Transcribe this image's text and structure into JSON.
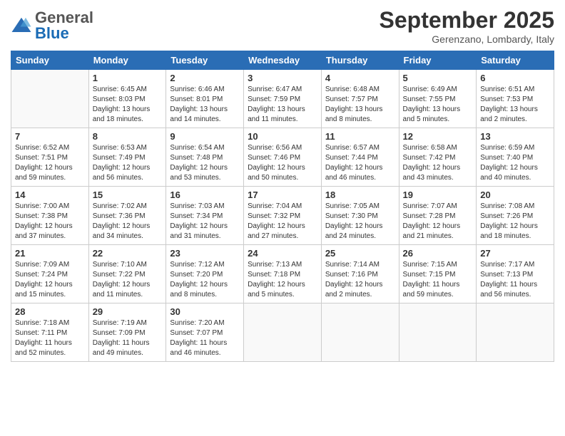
{
  "header": {
    "logo_general": "General",
    "logo_blue": "Blue",
    "title": "September 2025",
    "location": "Gerenzano, Lombardy, Italy"
  },
  "weekdays": [
    "Sunday",
    "Monday",
    "Tuesday",
    "Wednesday",
    "Thursday",
    "Friday",
    "Saturday"
  ],
  "weeks": [
    [
      {
        "day": "",
        "sunrise": "",
        "sunset": "",
        "daylight": ""
      },
      {
        "day": "1",
        "sunrise": "Sunrise: 6:45 AM",
        "sunset": "Sunset: 8:03 PM",
        "daylight": "Daylight: 13 hours and 18 minutes."
      },
      {
        "day": "2",
        "sunrise": "Sunrise: 6:46 AM",
        "sunset": "Sunset: 8:01 PM",
        "daylight": "Daylight: 13 hours and 14 minutes."
      },
      {
        "day": "3",
        "sunrise": "Sunrise: 6:47 AM",
        "sunset": "Sunset: 7:59 PM",
        "daylight": "Daylight: 13 hours and 11 minutes."
      },
      {
        "day": "4",
        "sunrise": "Sunrise: 6:48 AM",
        "sunset": "Sunset: 7:57 PM",
        "daylight": "Daylight: 13 hours and 8 minutes."
      },
      {
        "day": "5",
        "sunrise": "Sunrise: 6:49 AM",
        "sunset": "Sunset: 7:55 PM",
        "daylight": "Daylight: 13 hours and 5 minutes."
      },
      {
        "day": "6",
        "sunrise": "Sunrise: 6:51 AM",
        "sunset": "Sunset: 7:53 PM",
        "daylight": "Daylight: 13 hours and 2 minutes."
      }
    ],
    [
      {
        "day": "7",
        "sunrise": "Sunrise: 6:52 AM",
        "sunset": "Sunset: 7:51 PM",
        "daylight": "Daylight: 12 hours and 59 minutes."
      },
      {
        "day": "8",
        "sunrise": "Sunrise: 6:53 AM",
        "sunset": "Sunset: 7:49 PM",
        "daylight": "Daylight: 12 hours and 56 minutes."
      },
      {
        "day": "9",
        "sunrise": "Sunrise: 6:54 AM",
        "sunset": "Sunset: 7:48 PM",
        "daylight": "Daylight: 12 hours and 53 minutes."
      },
      {
        "day": "10",
        "sunrise": "Sunrise: 6:56 AM",
        "sunset": "Sunset: 7:46 PM",
        "daylight": "Daylight: 12 hours and 50 minutes."
      },
      {
        "day": "11",
        "sunrise": "Sunrise: 6:57 AM",
        "sunset": "Sunset: 7:44 PM",
        "daylight": "Daylight: 12 hours and 46 minutes."
      },
      {
        "day": "12",
        "sunrise": "Sunrise: 6:58 AM",
        "sunset": "Sunset: 7:42 PM",
        "daylight": "Daylight: 12 hours and 43 minutes."
      },
      {
        "day": "13",
        "sunrise": "Sunrise: 6:59 AM",
        "sunset": "Sunset: 7:40 PM",
        "daylight": "Daylight: 12 hours and 40 minutes."
      }
    ],
    [
      {
        "day": "14",
        "sunrise": "Sunrise: 7:00 AM",
        "sunset": "Sunset: 7:38 PM",
        "daylight": "Daylight: 12 hours and 37 minutes."
      },
      {
        "day": "15",
        "sunrise": "Sunrise: 7:02 AM",
        "sunset": "Sunset: 7:36 PM",
        "daylight": "Daylight: 12 hours and 34 minutes."
      },
      {
        "day": "16",
        "sunrise": "Sunrise: 7:03 AM",
        "sunset": "Sunset: 7:34 PM",
        "daylight": "Daylight: 12 hours and 31 minutes."
      },
      {
        "day": "17",
        "sunrise": "Sunrise: 7:04 AM",
        "sunset": "Sunset: 7:32 PM",
        "daylight": "Daylight: 12 hours and 27 minutes."
      },
      {
        "day": "18",
        "sunrise": "Sunrise: 7:05 AM",
        "sunset": "Sunset: 7:30 PM",
        "daylight": "Daylight: 12 hours and 24 minutes."
      },
      {
        "day": "19",
        "sunrise": "Sunrise: 7:07 AM",
        "sunset": "Sunset: 7:28 PM",
        "daylight": "Daylight: 12 hours and 21 minutes."
      },
      {
        "day": "20",
        "sunrise": "Sunrise: 7:08 AM",
        "sunset": "Sunset: 7:26 PM",
        "daylight": "Daylight: 12 hours and 18 minutes."
      }
    ],
    [
      {
        "day": "21",
        "sunrise": "Sunrise: 7:09 AM",
        "sunset": "Sunset: 7:24 PM",
        "daylight": "Daylight: 12 hours and 15 minutes."
      },
      {
        "day": "22",
        "sunrise": "Sunrise: 7:10 AM",
        "sunset": "Sunset: 7:22 PM",
        "daylight": "Daylight: 12 hours and 11 minutes."
      },
      {
        "day": "23",
        "sunrise": "Sunrise: 7:12 AM",
        "sunset": "Sunset: 7:20 PM",
        "daylight": "Daylight: 12 hours and 8 minutes."
      },
      {
        "day": "24",
        "sunrise": "Sunrise: 7:13 AM",
        "sunset": "Sunset: 7:18 PM",
        "daylight": "Daylight: 12 hours and 5 minutes."
      },
      {
        "day": "25",
        "sunrise": "Sunrise: 7:14 AM",
        "sunset": "Sunset: 7:16 PM",
        "daylight": "Daylight: 12 hours and 2 minutes."
      },
      {
        "day": "26",
        "sunrise": "Sunrise: 7:15 AM",
        "sunset": "Sunset: 7:15 PM",
        "daylight": "Daylight: 11 hours and 59 minutes."
      },
      {
        "day": "27",
        "sunrise": "Sunrise: 7:17 AM",
        "sunset": "Sunset: 7:13 PM",
        "daylight": "Daylight: 11 hours and 56 minutes."
      }
    ],
    [
      {
        "day": "28",
        "sunrise": "Sunrise: 7:18 AM",
        "sunset": "Sunset: 7:11 PM",
        "daylight": "Daylight: 11 hours and 52 minutes."
      },
      {
        "day": "29",
        "sunrise": "Sunrise: 7:19 AM",
        "sunset": "Sunset: 7:09 PM",
        "daylight": "Daylight: 11 hours and 49 minutes."
      },
      {
        "day": "30",
        "sunrise": "Sunrise: 7:20 AM",
        "sunset": "Sunset: 7:07 PM",
        "daylight": "Daylight: 11 hours and 46 minutes."
      },
      {
        "day": "",
        "sunrise": "",
        "sunset": "",
        "daylight": ""
      },
      {
        "day": "",
        "sunrise": "",
        "sunset": "",
        "daylight": ""
      },
      {
        "day": "",
        "sunrise": "",
        "sunset": "",
        "daylight": ""
      },
      {
        "day": "",
        "sunrise": "",
        "sunset": "",
        "daylight": ""
      }
    ]
  ]
}
